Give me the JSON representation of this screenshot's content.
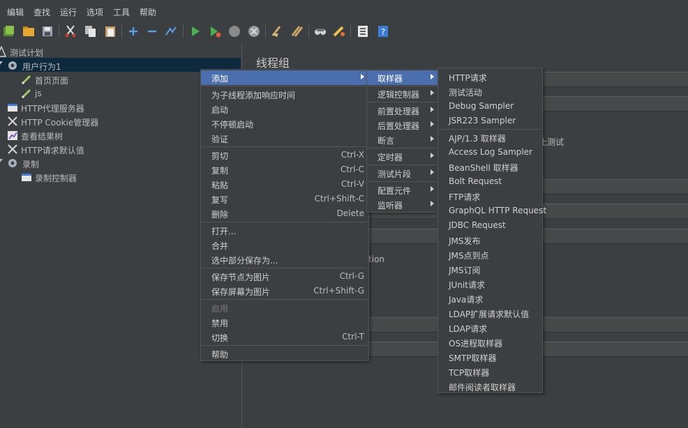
{
  "menubar": {
    "items": [
      "编辑",
      "查找",
      "运行",
      "选项",
      "工具",
      "帮助"
    ]
  },
  "toolbar": {
    "buttons": [
      "templates-icon",
      "open-icon",
      "save-icon",
      "cut-icon",
      "copy-icon",
      "paste-icon",
      "expand-icon",
      "collapse-icon",
      "toggle-icon",
      "start-icon",
      "start-no-pause-icon",
      "stop-icon",
      "shutdown-icon",
      "clear-icon",
      "clear-all-icon",
      "search-icon",
      "reset-search-icon",
      "function-helper-icon",
      "help-icon"
    ]
  },
  "tree": {
    "nodes": [
      {
        "label": "测试计划",
        "icon": "test-plan-icon"
      },
      {
        "label": "用户行为1",
        "icon": "thread-group-icon"
      },
      {
        "label": "首页页面",
        "icon": "sampler-icon"
      },
      {
        "label": "js",
        "icon": "sampler-icon"
      },
      {
        "label": "HTTP代理服务器",
        "icon": "proxy-icon"
      },
      {
        "label": "HTTP Cookie管理器",
        "icon": "config-icon"
      },
      {
        "label": "查看结果树",
        "icon": "listener-icon"
      },
      {
        "label": "HTTP请求默认值",
        "icon": "config-icon"
      },
      {
        "label": "录制",
        "icon": "thread-group-icon"
      },
      {
        "label": "录制控制器",
        "icon": "controller-icon"
      }
    ]
  },
  "panel": {
    "title": "线程组",
    "partial_stop": "止测试",
    "partial_action": "tion"
  },
  "context_menu": {
    "items": [
      {
        "label": "添加",
        "accel": "",
        "submenu": true
      },
      {
        "label": "为子线程添加响应时间",
        "accel": ""
      },
      {
        "label": "启动",
        "accel": ""
      },
      {
        "label": "不停顿启动",
        "accel": ""
      },
      {
        "label": "验证",
        "accel": ""
      },
      {
        "label": "剪切",
        "accel": "Ctrl-X"
      },
      {
        "label": "复制",
        "accel": "Ctrl-C"
      },
      {
        "label": "粘贴",
        "accel": "Ctrl-V"
      },
      {
        "label": "复写",
        "accel": "Ctrl+Shift-C"
      },
      {
        "label": "删除",
        "accel": "Delete"
      },
      {
        "label": "打开...",
        "accel": ""
      },
      {
        "label": "合并",
        "accel": ""
      },
      {
        "label": "选中部分保存为...",
        "accel": ""
      },
      {
        "label": "保存节点为图片",
        "accel": "Ctrl-G"
      },
      {
        "label": "保存屏幕为图片",
        "accel": "Ctrl+Shift-G"
      },
      {
        "label": "启用",
        "accel": "",
        "disabled": true
      },
      {
        "label": "禁用",
        "accel": ""
      },
      {
        "label": "切换",
        "accel": "Ctrl-T"
      },
      {
        "label": "帮助",
        "accel": ""
      }
    ]
  },
  "add_submenu": {
    "items": [
      "取样器",
      "逻辑控制器",
      "前置处理器",
      "后置处理器",
      "断言",
      "定时器",
      "测试片段",
      "配置元件",
      "监听器"
    ]
  },
  "sampler_submenu": {
    "items": [
      "HTTP请求",
      "测试活动",
      "Debug Sampler",
      "JSR223 Sampler",
      "AJP/1.3 取样器",
      "Access Log Sampler",
      "BeanShell 取样器",
      "Bolt Request",
      "FTP请求",
      "GraphQL HTTP Request",
      "JDBC Request",
      "JMS发布",
      "JMS点到点",
      "JMS订阅",
      "JUnit请求",
      "Java请求",
      "LDAP扩展请求默认值",
      "LDAP请求",
      "OS进程取样器",
      "SMTP取样器",
      "TCP取样器",
      "邮件阅读者取样器"
    ]
  },
  "colors": {
    "background": "#3c3f41",
    "selection": "#4b6eaf",
    "tree_selection": "#0d293e"
  }
}
